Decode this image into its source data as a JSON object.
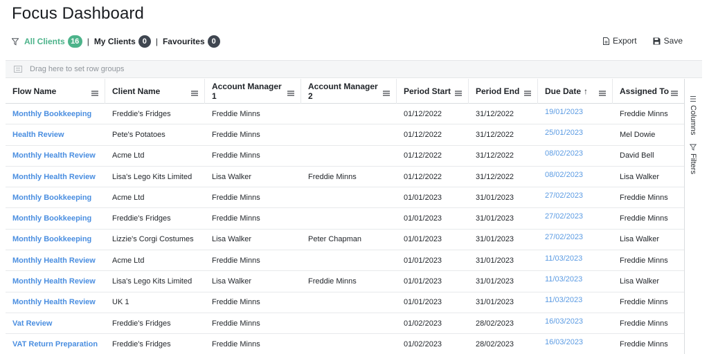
{
  "page": {
    "title": "Focus Dashboard"
  },
  "filters": {
    "all": {
      "label": "All Clients",
      "count": "16"
    },
    "mine": {
      "label": "My Clients",
      "count": "0"
    },
    "favourites": {
      "label": "Favourites",
      "count": "0"
    },
    "separator": "|"
  },
  "toolbar": {
    "export_label": "Export",
    "save_label": "Save"
  },
  "groupbar": {
    "placeholder": "Drag here to set row groups"
  },
  "sidepanel": {
    "columns_label": "Columns",
    "filters_label": "Filters"
  },
  "table": {
    "columns": [
      "Flow Name",
      "Client Name",
      "Account Manager 1",
      "Account Manager 2",
      "Period Start",
      "Period End",
      "Due Date",
      "Assigned To"
    ],
    "sort_indicator": "↑",
    "rows": [
      [
        "Monthly Bookkeeping",
        "Freddie's Fridges",
        "Freddie Minns",
        "",
        "01/12/2022",
        "31/12/2022",
        "19/01/2023",
        "Freddie Minns"
      ],
      [
        "Health Review",
        "Pete's Potatoes",
        "Freddie Minns",
        "",
        "01/12/2022",
        "31/12/2022",
        "25/01/2023",
        "Mel Dowie"
      ],
      [
        "Monthly Health Review",
        "Acme Ltd",
        "Freddie Minns",
        "",
        "01/12/2022",
        "31/12/2022",
        "08/02/2023",
        "David Bell"
      ],
      [
        "Monthly Health Review",
        "Lisa's Lego Kits Limited",
        "Lisa Walker",
        "Freddie Minns",
        "01/12/2022",
        "31/12/2022",
        "08/02/2023",
        "Lisa Walker"
      ],
      [
        "Monthly Bookkeeping",
        "Acme Ltd",
        "Freddie Minns",
        "",
        "01/01/2023",
        "31/01/2023",
        "27/02/2023",
        "Freddie Minns"
      ],
      [
        "Monthly Bookkeeping",
        "Freddie's Fridges",
        "Freddie Minns",
        "",
        "01/01/2023",
        "31/01/2023",
        "27/02/2023",
        "Freddie Minns"
      ],
      [
        "Monthly Bookkeeping",
        "Lizzie's Corgi Costumes",
        "Lisa Walker",
        "Peter Chapman",
        "01/01/2023",
        "31/01/2023",
        "27/02/2023",
        "Lisa Walker"
      ],
      [
        "Monthly Health Review",
        "Acme Ltd",
        "Freddie Minns",
        "",
        "01/01/2023",
        "31/01/2023",
        "11/03/2023",
        "Freddie Minns"
      ],
      [
        "Monthly Health Review",
        "Lisa's Lego Kits Limited",
        "Lisa Walker",
        "Freddie Minns",
        "01/01/2023",
        "31/01/2023",
        "11/03/2023",
        "Lisa Walker"
      ],
      [
        "Monthly Health Review",
        "UK 1",
        "Freddie Minns",
        "",
        "01/01/2023",
        "31/01/2023",
        "11/03/2023",
        "Freddie Minns"
      ],
      [
        "Vat Review",
        "Freddie's Fridges",
        "Freddie Minns",
        "",
        "01/02/2023",
        "28/02/2023",
        "16/03/2023",
        "Freddie Minns"
      ],
      [
        "VAT Return Preparation",
        "Freddie's Fridges",
        "Freddie Minns",
        "",
        "01/02/2023",
        "28/02/2023",
        "16/03/2023",
        "Freddie Minns"
      ]
    ]
  },
  "colors": {
    "accent_green": "#4cb38a",
    "link_blue": "#4a8ee0",
    "badge_dark": "#3f4650"
  },
  "icons": {
    "filter": "funnel-icon",
    "export": "file-icon",
    "save": "floppy-icon",
    "menu": "hamburger-icon",
    "group": "row-group-icon",
    "columns": "columns-icon"
  }
}
